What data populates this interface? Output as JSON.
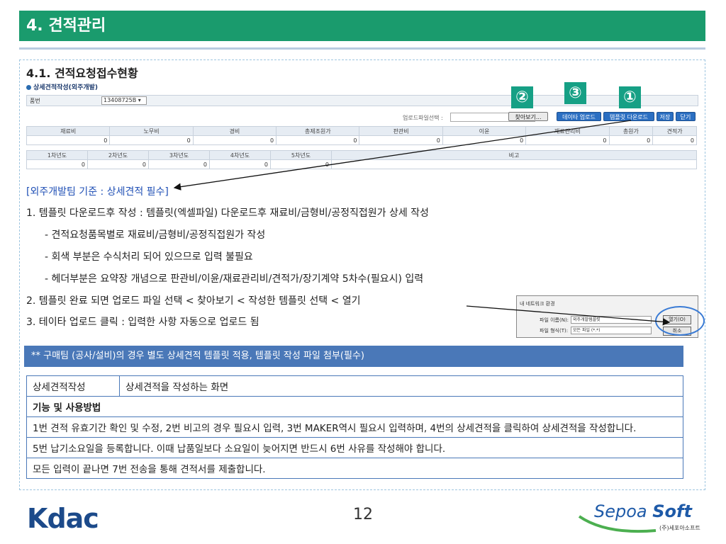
{
  "header": {
    "title": "4. 견적관리"
  },
  "section": {
    "title": "4.1. 견적요청접수현황"
  },
  "screenshot": {
    "form_title": "상세견적작성(외주개발)",
    "part_no_label": "품번",
    "part_no_value": "13408725B",
    "upload_label": "업로드파일선택 :",
    "buttons": [
      "찾아보기...",
      "데이타 업로드",
      "템플릿 다운로드",
      "저장",
      "닫기"
    ],
    "markers": [
      "②",
      "③",
      "①"
    ],
    "cost_headers": [
      "재료비",
      "노무비",
      "경비",
      "총제조원가",
      "판관비",
      "이윤",
      "재료관리비",
      "총원가",
      "견적가"
    ],
    "cost_values": [
      "0",
      "0",
      "0",
      "0",
      "0",
      "0",
      "0",
      "0",
      "0"
    ],
    "year_headers": [
      "1차년도",
      "2차년도",
      "3차년도",
      "4차년도",
      "5차년도",
      "비고"
    ],
    "year_values": [
      "0",
      "0",
      "0",
      "0",
      "0",
      ""
    ]
  },
  "body": {
    "note_blue": "[외주개발팀 기준 : 상세견적 필수]",
    "line1": "1. 템플릿 다운로드후 작성 : 템플릿(엑셀파일) 다운로드후 재료비/금형비/공정직접원가 상세 작성",
    "sub1": "- 견적요청품목별로 재료비/금형비/공정직접원가 작성",
    "sub2": "- 회색 부분은 수식처리 되어 있으므로 입력 불필요",
    "sub3": "- 헤더부분은 요약장 개념으로 판관비/이윤/재료관리비/견적가/장기계약 5차수(필요시) 입력",
    "line2": "2. 템플릿 완료 되면 업로드 파일 선택 < 찾아보기 < 작성한 템플릿 선택 < 열기",
    "line3": "3. 테이타 업로드 클릭 : 입력한 사항 자동으로 업로드 됨"
  },
  "dialog": {
    "title": "내 네트워크 환경",
    "file_name_label": "파일 이름(N):",
    "file_name_value": "외주개발템플릿",
    "file_type_label": "파일 형식(T):",
    "file_type_value": "모든 파일 (*.*)",
    "open_button": "열기(O)",
    "cancel_button": "취소"
  },
  "banner": {
    "text": "** 구매팀 (공사/설비)의 경우 별도 상세견적 템플릿 적용, 템플릿 작성 파일 첨부(필수)"
  },
  "info_table": {
    "screen_label": "상세견적작성",
    "screen_desc": "상세견적을 작성하는 화면",
    "usage_heading": "기능 및 사용방법",
    "rows": [
      "1번 견적 유효기간 확인 및 수정, 2번 비고의 경우 필요시 입력, 3번 MAKER역시 필요시 입력하며, 4번의 상세견적을 클릭하여 상세견적을 작성합니다.",
      "5번 납기소요일을 등록합니다. 이때 납품일보다 소요일이 늦어지면 반드시 6번 사유를 작성해야 합니다.",
      "모든 입력이 끝나면 7번 전송을 통해 견적서를 제출합니다."
    ]
  },
  "footer": {
    "left_logo": "Kdac",
    "page_number": "12",
    "right_logo_a": "Sepoa",
    "right_logo_b": "Soft",
    "right_logo_sub": "(주)세포아소프트"
  },
  "colors": {
    "title_bg": "#1a9b6d",
    "banner_bg": "#4a78b8",
    "marker_bg": "#16a085",
    "note_text": "#1f4fb5"
  }
}
